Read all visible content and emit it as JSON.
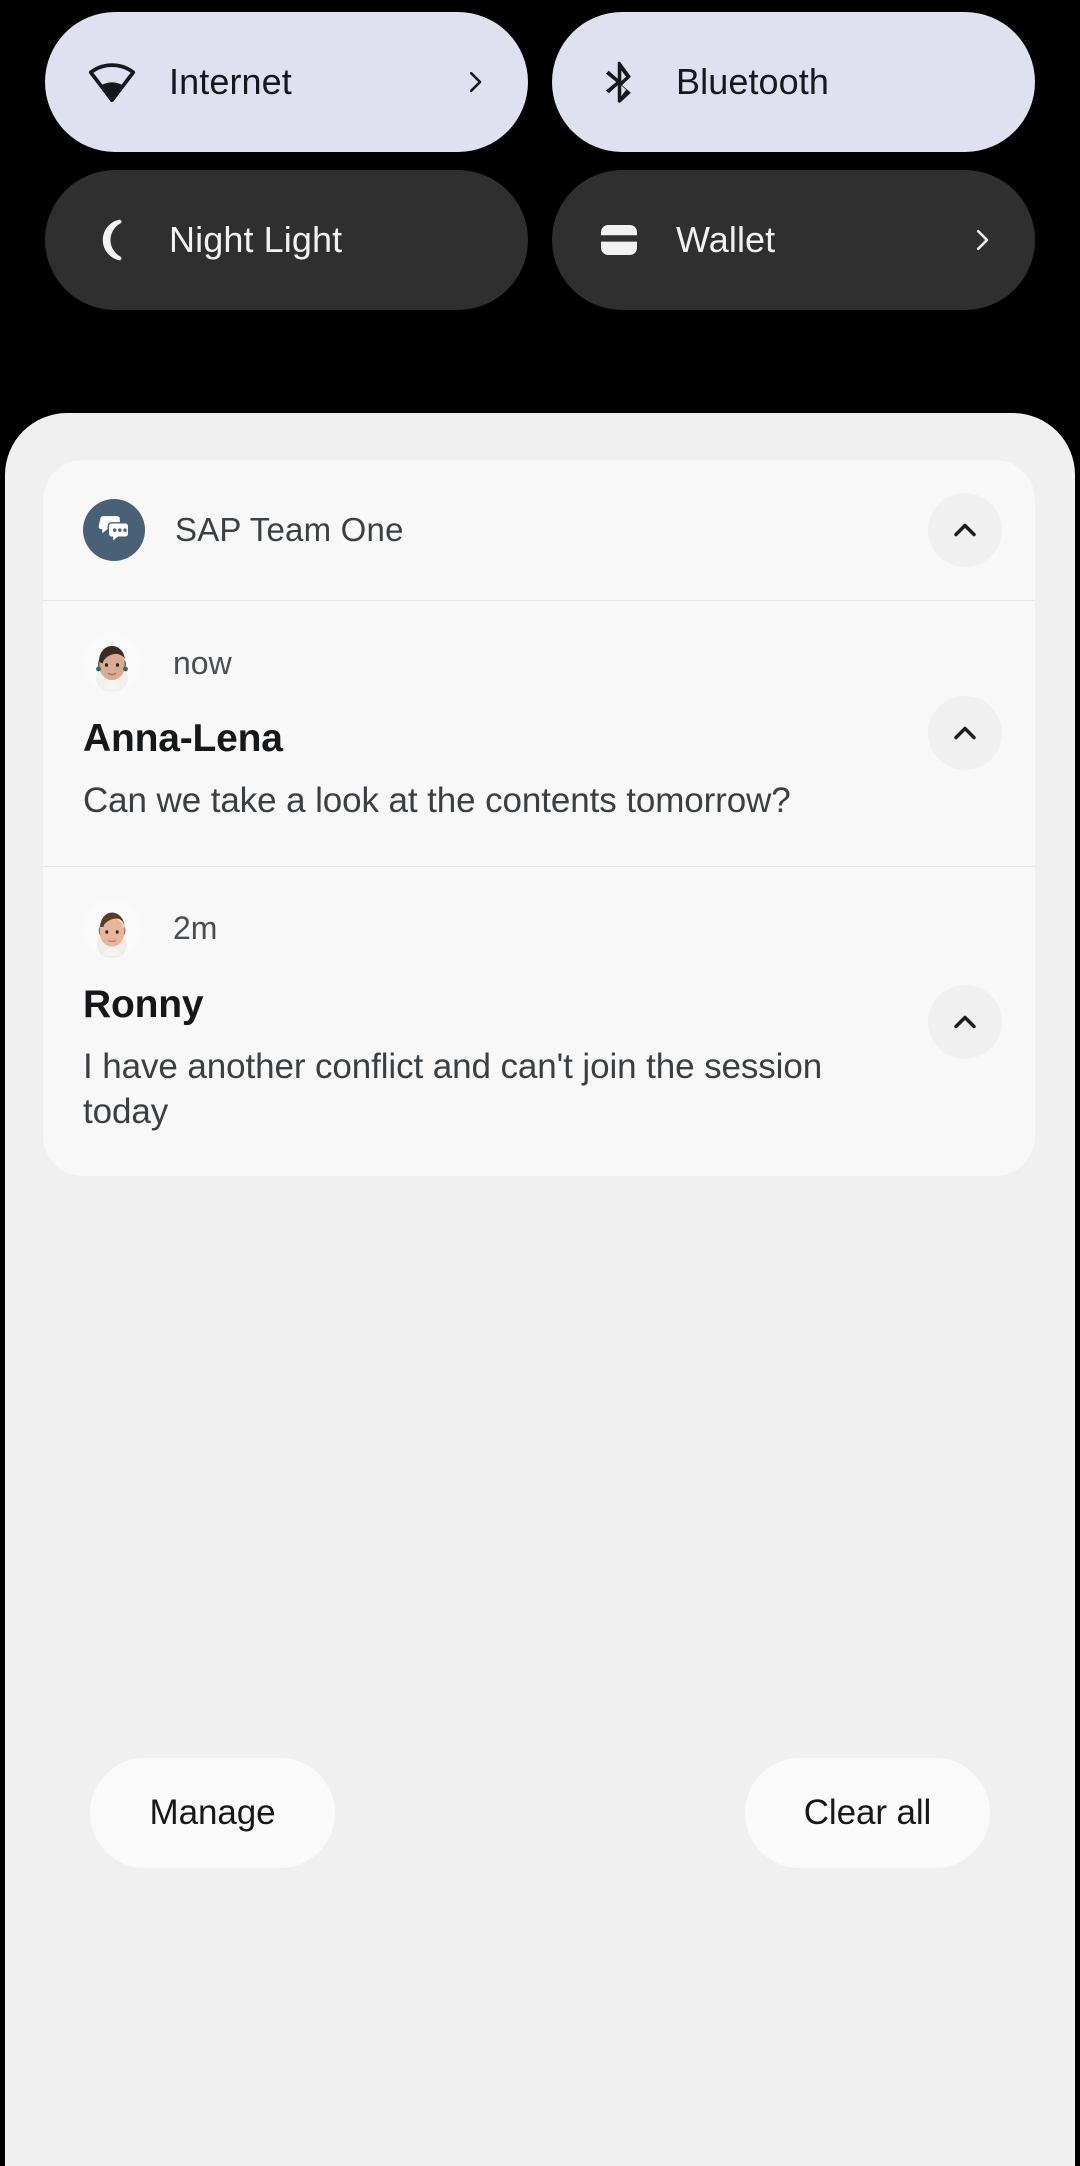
{
  "quick_settings": {
    "tiles": [
      {
        "label": "Internet",
        "icon": "wifi-icon",
        "state": "active",
        "has_chevron": true
      },
      {
        "label": "Bluetooth",
        "icon": "bluetooth-icon",
        "state": "active",
        "has_chevron": false
      },
      {
        "label": "Night Light",
        "icon": "moon-icon",
        "state": "inactive",
        "has_chevron": false
      },
      {
        "label": "Wallet",
        "icon": "wallet-icon",
        "state": "inactive",
        "has_chevron": true
      }
    ],
    "colors": {
      "active_bg": "#dfe1f1",
      "active_fg": "#16181d",
      "inactive_bg": "#302f2f",
      "inactive_fg": "#f2f2f2",
      "screen_bg": "#000000"
    }
  },
  "notification_shade": {
    "panel_bg": "#f1f0f0",
    "card_bg": "#f9f8f8",
    "group": {
      "app_name": "SAP Team One",
      "app_icon": "chat-bubbles-icon",
      "app_icon_color": "#4a6076",
      "collapse_icon": "chevron-up-icon"
    },
    "messages": [
      {
        "time": "now",
        "sender": "Anna-Lena",
        "text": "Can we take a look at the contents tomorrow?",
        "avatar": "avatar-anna-lena",
        "collapse_icon": "chevron-up-icon"
      },
      {
        "time": "2m",
        "sender": "Ronny",
        "text": "I have another conflict and can't join the session today",
        "avatar": "avatar-ronny",
        "collapse_icon": "chevron-up-icon"
      }
    ],
    "actions": {
      "manage_label": "Manage",
      "clear_all_label": "Clear all"
    }
  }
}
